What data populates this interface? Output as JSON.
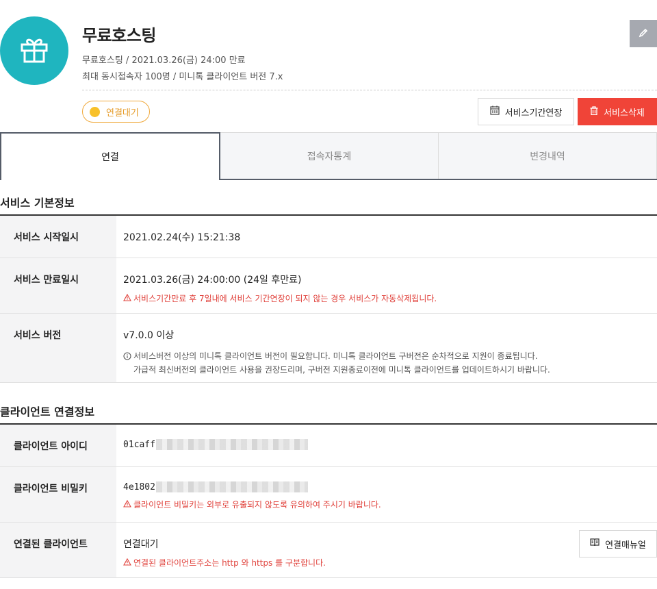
{
  "header": {
    "title": "무료호스팅",
    "meta_line1": "무료호스팅 / 2021.03.26(금) 24:00 만료",
    "meta_line2": "최대 동시접속자 100명 / 미니톡 클라이언트 버전 7.x",
    "status": "연결대기",
    "extend_button": "서비스기간연장",
    "delete_button": "서비스삭제",
    "logo_icon": "gift-icon",
    "edit_icon": "pencil-icon"
  },
  "tabs": [
    {
      "label": "연결",
      "active": true
    },
    {
      "label": "접속자통계",
      "active": false
    },
    {
      "label": "변경내역",
      "active": false
    }
  ],
  "basic_info": {
    "title": "서비스 기본정보",
    "start_label": "서비스 시작일시",
    "start_value": "2021.02.24(수) 15:21:38",
    "end_label": "서비스 만료일시",
    "end_value": "2021.03.26(금) 24:00:00 (24일 후만료)",
    "end_warning": "서비스기간만료 후 7일내에 서비스 기간연장이 되지 않는 경우 서비스가 자동삭제됩니다.",
    "version_label": "서비스 버전",
    "version_value": "v7.0.0 이상",
    "version_info_1": "서비스버전 이상의 미니톡 클라이언트 버전이 필요합니다. 미니톡 클라이언트 구버전은 순차적으로 지원이 종료됩니다.",
    "version_info_2": "가급적 최신버전의 클라이언트 사용을 권장드리며, 구버전 지원종료이전에 미니톡 클라이언트를 업데이트하시기 바랍니다."
  },
  "client_info": {
    "title": "클라이언트 연결정보",
    "id_label": "클라이언트 아이디",
    "id_value": "01caff",
    "secret_label": "클라이언트 비밀키",
    "secret_value": "4e1802",
    "secret_warning": "클라이언트 비밀키는 외부로 유출되지 않도록 유의하여 주시기 바랍니다.",
    "connected_label": "연결된 클라이언트",
    "connected_value": "연결대기",
    "connected_warning": "연결된 클라이언트주소는 http 와 https 를 구분합니다.",
    "manual_button": "연결매뉴얼"
  },
  "colors": {
    "logo_bg": "#1fb5bf",
    "delete_bg": "#f04438",
    "status_border": "#f0a83a",
    "warning_text": "#e0403a"
  }
}
